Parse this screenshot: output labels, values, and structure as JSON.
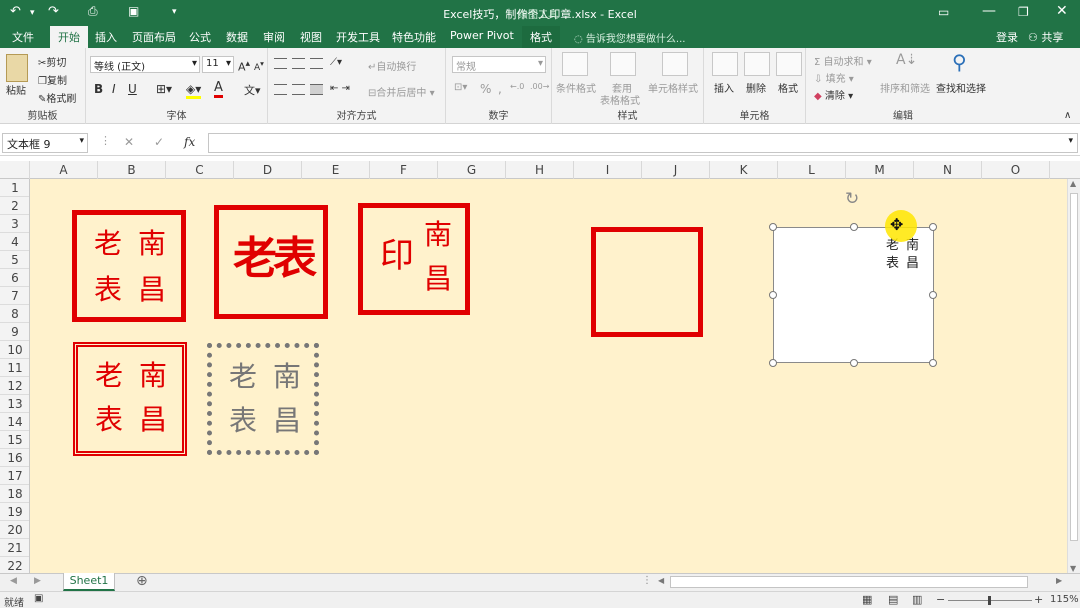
{
  "title": "Excel技巧，制作个人印章.xlsx - Excel",
  "title_overlay": "绘图工具",
  "quick_access": {
    "undo": "↶",
    "redo": "↷"
  },
  "tabs": [
    "文件",
    "开始",
    "插入",
    "页面布局",
    "公式",
    "数据",
    "审阅",
    "视图",
    "开发工具",
    "特色功能",
    "Power Pivot",
    "格式"
  ],
  "tell_me": "告诉我您想要做什么...",
  "account": {
    "login": "登录",
    "share": "共享"
  },
  "ribbon": {
    "clipboard": {
      "paste": "粘贴",
      "cut": "剪切",
      "copy": "复制",
      "format_painter": "格式刷",
      "label": "剪贴板"
    },
    "font": {
      "name": "等线 (正文)",
      "size": "11",
      "bold": "B",
      "italic": "I",
      "underline": "U",
      "color_a": "A",
      "label": "字体"
    },
    "alignment": {
      "wrap": "自动换行",
      "merge": "合并后居中",
      "label": "对齐方式"
    },
    "number": {
      "format": "常规",
      "percent": "%",
      "label": "数字"
    },
    "styles": {
      "conditional": "条件格式",
      "table_fmt_1": "套用",
      "table_fmt_2": "表格格式",
      "cell_style": "单元格样式",
      "label": "样式"
    },
    "cells": {
      "insert": "插入",
      "delete": "删除",
      "format": "格式",
      "label": "单元格"
    },
    "editing": {
      "autosum": "自动求和",
      "fill": "填充",
      "clear": "清除",
      "sort": "排序和筛选",
      "find": "查找和选择",
      "label": "编辑"
    }
  },
  "formula_bar": {
    "name_box": "文本框 9",
    "fx": "fx",
    "cancel": "✕",
    "enter": "✓"
  },
  "columns": [
    "A",
    "B",
    "C",
    "D",
    "E",
    "F",
    "G",
    "H",
    "I",
    "J",
    "K",
    "L",
    "M",
    "N",
    "O"
  ],
  "rows": [
    "1",
    "2",
    "3",
    "4",
    "5",
    "6",
    "7",
    "8",
    "9",
    "10",
    "11",
    "12",
    "13",
    "14",
    "15",
    "16",
    "17",
    "18",
    "19",
    "20",
    "21",
    "22"
  ],
  "seals": {
    "chars": {
      "lao": "老",
      "nan": "南",
      "biao": "表",
      "chang": "昌",
      "yin": "印"
    }
  },
  "textbox_text": {
    "lao": "老",
    "nan": "南",
    "biao": "表",
    "chang": "昌"
  },
  "sheet_tab": "Sheet1",
  "status": {
    "ready": "就绪",
    "zoom": "115%"
  },
  "colors": {
    "excel_green": "#217346",
    "seal_red": "#e00000",
    "sheet_bg": "#fff2cc",
    "gray_seal": "#777777"
  }
}
